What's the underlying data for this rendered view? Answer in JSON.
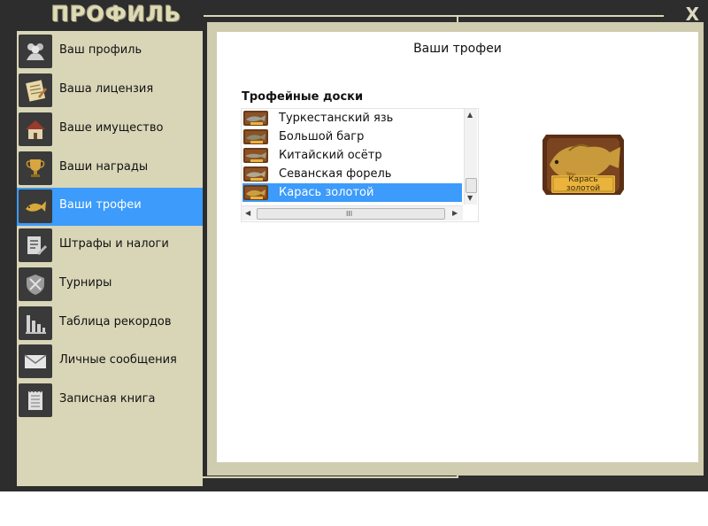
{
  "window": {
    "title": "ПРОФИЛЬ",
    "close_label": "X"
  },
  "sidebar": {
    "items": [
      {
        "label": "Ваш профиль",
        "icon": "users-icon",
        "active": false
      },
      {
        "label": "Ваша лицензия",
        "icon": "license-icon",
        "active": false
      },
      {
        "label": "Ваше имущество",
        "icon": "house-icon",
        "active": false
      },
      {
        "label": "Ваши награды",
        "icon": "trophy-cup-icon",
        "active": false
      },
      {
        "label": "Ваши трофеи",
        "icon": "fish-trophy-icon",
        "active": true
      },
      {
        "label": "Штрафы и налоги",
        "icon": "fines-icon",
        "active": false
      },
      {
        "label": "Турниры",
        "icon": "tournament-shield-icon",
        "active": false
      },
      {
        "label": "Таблица рекордов",
        "icon": "bar-chart-icon",
        "active": false
      },
      {
        "label": "Личные сообщения",
        "icon": "envelope-icon",
        "active": false
      },
      {
        "label": "Записная книга",
        "icon": "notebook-icon",
        "active": false
      }
    ]
  },
  "main": {
    "title": "Ваши трофеи",
    "section_title": "Трофейные доски",
    "trophies": [
      {
        "name": "Туркестанский язь",
        "selected": false
      },
      {
        "name": "Большой багр",
        "selected": false
      },
      {
        "name": "Китайский осётр",
        "selected": false
      },
      {
        "name": "Севанская форель",
        "selected": false
      },
      {
        "name": "Карась золотой",
        "selected": true
      }
    ],
    "scroll_grip": "III",
    "preview": {
      "plaque_text": "Карась золотой"
    }
  },
  "colors": {
    "accent": "#3c9bfb",
    "frame": "#2d2d2d",
    "panel": "#d9d6b8",
    "plaque_wood": "#5a2f14",
    "plaque_gold": "#e9b33c"
  }
}
